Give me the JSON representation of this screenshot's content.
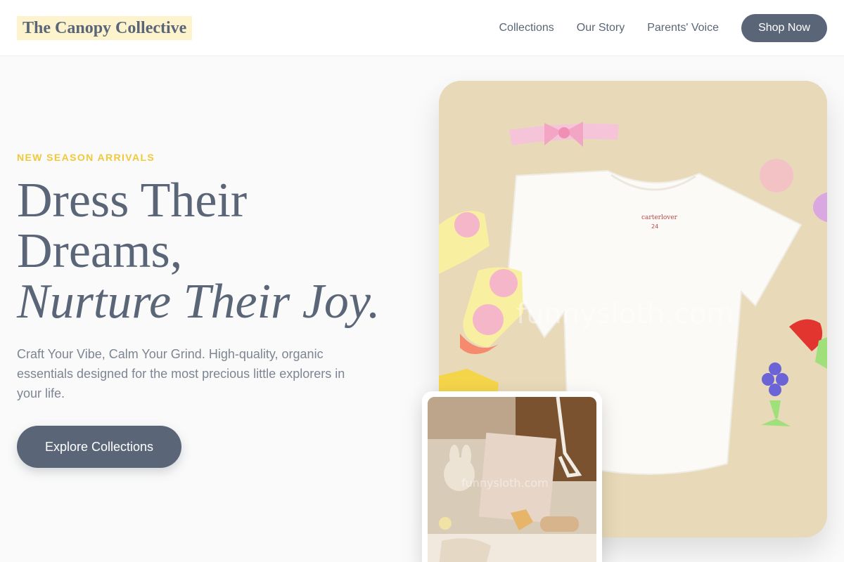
{
  "brand": {
    "name": "The Canopy Collective"
  },
  "nav": {
    "links": [
      "Collections",
      "Our Story",
      "Parents' Voice"
    ],
    "cta_label": "Shop Now"
  },
  "hero": {
    "eyebrow": "NEW SEASON ARRIVALS",
    "headline_line1": "Dress Their",
    "headline_line2": "Dreams,",
    "headline_line3": "Nurture Their Joy.",
    "subtext": "Craft Your Vibe, Calm Your Grind. High-quality, organic essentials designed for the most precious little explorers in your life.",
    "cta_label": "Explore Collections"
  },
  "images": {
    "main_alt": "White baby t-shirt flat lay with pink headband, bear socks and teether toys",
    "main_tag_brand": "carterlover",
    "main_tag_size": "24",
    "inset_alt": "Baby gift set with bunny toy, blank card, brush and ribbon",
    "watermark": "funnysloth.com"
  },
  "colors": {
    "accent": "#5a6678",
    "highlight": "#fdf3cc",
    "eyebrow": "#f0c93a",
    "background": "#fafafa"
  }
}
